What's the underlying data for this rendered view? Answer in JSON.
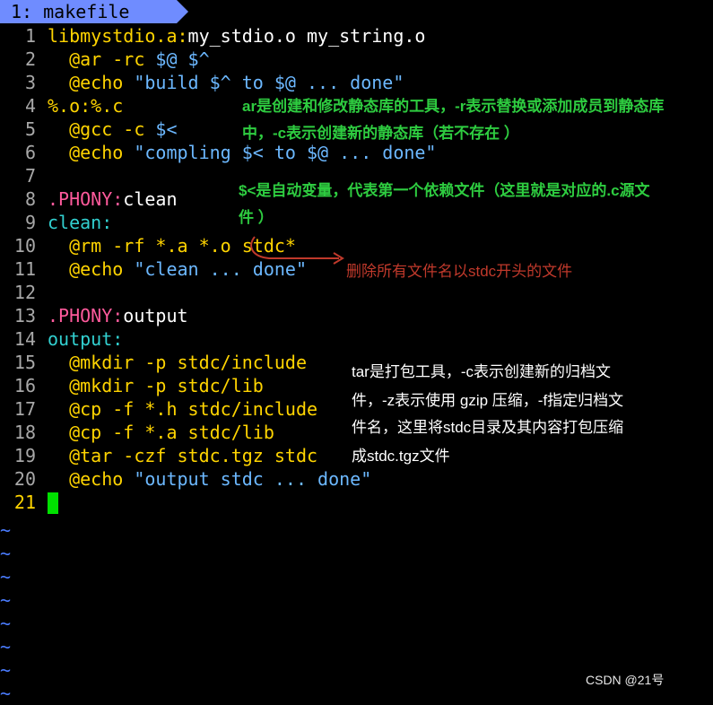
{
  "tab": {
    "label": "1: makefile"
  },
  "lines": [
    {
      "num": "1",
      "segs": [
        [
          "libmystdio.a:",
          "t-target"
        ],
        [
          "my_stdio.o my_string.o",
          "t-plain"
        ]
      ]
    },
    {
      "num": "2",
      "segs": [
        [
          "  @ar -rc ",
          "t-cmd"
        ],
        [
          "$@ $^",
          "t-var"
        ]
      ]
    },
    {
      "num": "3",
      "segs": [
        [
          "  @echo ",
          "t-cmd"
        ],
        [
          "\"build $^ to $@ ... done\"",
          "t-str"
        ]
      ]
    },
    {
      "num": "4",
      "segs": [
        [
          "%.o:%.c",
          "t-target"
        ]
      ]
    },
    {
      "num": "5",
      "segs": [
        [
          "  @gcc -c ",
          "t-cmd"
        ],
        [
          "$<",
          "t-var"
        ]
      ]
    },
    {
      "num": "6",
      "segs": [
        [
          "  @echo ",
          "t-cmd"
        ],
        [
          "\"compling $< to $@ ... done\"",
          "t-str"
        ]
      ]
    },
    {
      "num": "7",
      "segs": []
    },
    {
      "num": "8",
      "segs": [
        [
          ".PHONY:",
          "t-kw"
        ],
        [
          "clean",
          "t-plain"
        ]
      ]
    },
    {
      "num": "9",
      "segs": [
        [
          "clean:",
          "t-sec"
        ]
      ]
    },
    {
      "num": "10",
      "segs": [
        [
          "  @rm -rf *.a *.o stdc*",
          "t-cmd"
        ]
      ]
    },
    {
      "num": "11",
      "segs": [
        [
          "  @echo ",
          "t-cmd"
        ],
        [
          "\"clean ... done\"",
          "t-str"
        ]
      ]
    },
    {
      "num": "12",
      "segs": []
    },
    {
      "num": "13",
      "segs": [
        [
          ".PHONY:",
          "t-kw"
        ],
        [
          "output",
          "t-plain"
        ]
      ]
    },
    {
      "num": "14",
      "segs": [
        [
          "output:",
          "t-sec"
        ]
      ]
    },
    {
      "num": "15",
      "segs": [
        [
          "  @mkdir -p stdc/include",
          "t-cmd"
        ]
      ]
    },
    {
      "num": "16",
      "segs": [
        [
          "  @mkdir -p stdc/lib",
          "t-cmd"
        ]
      ]
    },
    {
      "num": "17",
      "segs": [
        [
          "  @cp -f *.h stdc/include",
          "t-cmd"
        ]
      ]
    },
    {
      "num": "18",
      "segs": [
        [
          "  @cp -f *.a stdc/lib",
          "t-cmd"
        ]
      ]
    },
    {
      "num": "19",
      "segs": [
        [
          "  @tar -czf stdc.tgz stdc",
          "t-cmd"
        ]
      ]
    },
    {
      "num": "20",
      "segs": [
        [
          "  @echo ",
          "t-cmd"
        ],
        [
          "\"output stdc ... done\"",
          "t-str"
        ]
      ]
    },
    {
      "num": "21",
      "segs": [],
      "current": true
    }
  ],
  "tilde_glyph": "~",
  "tilde_count": 8,
  "annotations": {
    "ar_note_1": "ar是创建和修改静态库的工具，-r表示替换或添加成员到静态库",
    "ar_note_2": "中，-c表示创建新的静态库（若不存在 ）",
    "var_note_1": "$<是自动变量，代表第一个依赖文件（这里就是对应的.c源文",
    "var_note_2": "件 ）",
    "rm_note": "删除所有文件名以stdc开头的文件",
    "tar_note_1": "tar是打包工具，-c表示创建新的归档文",
    "tar_note_2": "件，-z表示使用 gzip 压缩，-f指定归档文",
    "tar_note_3": "件名，这里将stdc目录及其内容打包压缩",
    "tar_note_4": "成stdc.tgz文件"
  },
  "watermark": "CSDN @21号",
  "colors": {
    "tab_bg": "#6f8cff",
    "cursor": "#00e000",
    "annotation_green": "#2ecc40",
    "annotation_red": "#c0392b"
  }
}
